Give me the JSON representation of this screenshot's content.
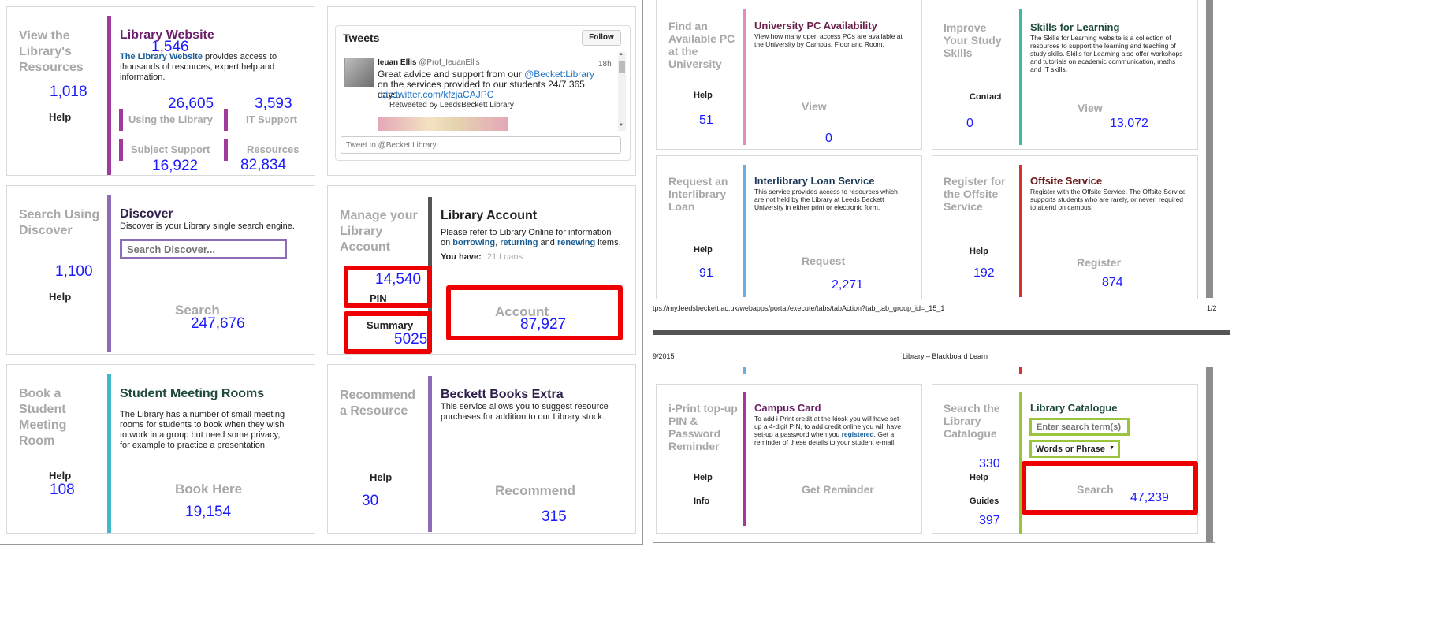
{
  "colors": {
    "purple": "#8e44ad",
    "magenta": "#a13a9b",
    "gray_bar": "#555555",
    "teal": "#3fb8b0",
    "pink": "#e07bb5",
    "blue_bar": "#6aaee0",
    "red_bar": "#d9322b",
    "green_bar": "#9ac43a",
    "red_box": "#ee0000",
    "num_blue": "#1a1aff"
  },
  "left": {
    "resources": {
      "label": "View the Library's Resources",
      "title": "Library Website",
      "title_count": "1,546",
      "desc_link": "The Library Website",
      "desc_rest": " provides access to thousands of resources, expert help and information.",
      "count": "1,018",
      "help": "Help",
      "sub": [
        {
          "label": "Using the Library",
          "count": "26,605"
        },
        {
          "label": "IT Support",
          "count": "3,593"
        },
        {
          "label": "Subject Support",
          "count": "16,922"
        },
        {
          "label": "Resources",
          "count": "82,834"
        }
      ]
    },
    "tweets": {
      "title": "Tweets",
      "follow": "Follow",
      "author": "Ieuan Ellis",
      "handle": "@Prof_IeuanEllis",
      "time": "18h",
      "text1": "Great advice and support from our ",
      "mention": "@BeckettLibrary",
      "text2": " on the services provided to our students 24/7 365 days.",
      "url": "pic.twitter.com/kfzjaCAJPC",
      "retweet": "Retweeted by LeedsBeckett Library",
      "compose_placeholder": "Tweet to @BeckettLibrary"
    },
    "discover": {
      "label": "Search Using Discover",
      "title": "Discover",
      "desc": "Discover is your Library single search engine.",
      "search_placeholder": "Search Discover...",
      "count": "1,100",
      "help": "Help",
      "search": "Search",
      "search_count": "247,676"
    },
    "account": {
      "label": "Manage your Library Account",
      "title": "Library Account",
      "desc1": "Please refer to Library Online for information on ",
      "b1": "borrowing",
      "sep1": ", ",
      "b2": "returning",
      "sep2": " and ",
      "b3": "renewing",
      "desc2": " items.",
      "you_have": "You have:",
      "loans": "21 Loans",
      "pin_count": "14,540",
      "pin": "PIN",
      "summary": "Summary",
      "summary_count": "5025",
      "account": "Account",
      "account_count": "87,927"
    },
    "rooms": {
      "label": "Book a Student Meeting Room",
      "title": "Student Meeting Rooms",
      "desc": "The Library has a number of small meeting rooms for students to book when they wish to work in a group but need some privacy, for example to practice a presentation.",
      "help": "Help",
      "help_count": "108",
      "book": "Book Here",
      "book_count": "19,154"
    },
    "recommend": {
      "label": "Recommend a Resource",
      "title": "Beckett Books Extra",
      "desc": "This service allows you to suggest resource purchases for addition to our Library stock.",
      "help": "Help",
      "help_count": "30",
      "recommend": "Recommend",
      "recommend_count": "315"
    }
  },
  "right": {
    "pc": {
      "label": "Find an Available PC at the University",
      "title": "University PC Availability",
      "desc": "View how many open access PCs are available at the University by Campus, Floor and Room.",
      "help": "Help",
      "help_count": "51",
      "view": "View",
      "view_count": "0"
    },
    "skills": {
      "label": "Improve Your Study Skills",
      "title": "Skills for Learning",
      "desc": "The Skills for Learning website is a collection of resources to support the learning and teaching of study skills. Skills for Learning also offer workshops and tutorials on academic communication, maths and IT skills.",
      "contact": "Contact",
      "contact_count": "0",
      "view": "View",
      "view_count": "13,072"
    },
    "ill": {
      "label": "Request an Interlibrary Loan",
      "title": "Interlibrary Loan Service",
      "desc": "This service provides access to resources which are not held by the Library at Leeds Beckett University in either print or electronic form.",
      "help": "Help",
      "help_count": "91",
      "request": "Request",
      "request_count": "2,271"
    },
    "offsite": {
      "label": "Register for the Offsite Service",
      "title": "Offsite Service",
      "desc": "Register with the Offsite Service. The Offsite Service supports students who are rarely, or never, required to attend on campus.",
      "help": "Help",
      "help_count": "192",
      "register": "Register",
      "register_count": "874"
    },
    "footer_url": "tps://my.leedsbeckett.ac.uk/webapps/portal/execute/tabs/tabAction?tab_tab_group_id=_15_1",
    "footer_page": "1/2",
    "header_date": "9/2015",
    "header_title": "Library – Blackboard Learn",
    "campus": {
      "label": "i-Print top-up PIN & Password Reminder",
      "title": "Campus Card",
      "desc1": "To add i-Print credit at the kiosk you will have set-up a 4-digit PIN, to add credit online you will have set-up a password when you ",
      "desc_link": "registered",
      "desc2": ". Get a reminder of these details to your student e-mail.",
      "help": "Help",
      "info": "Info",
      "reminder": "Get Reminder"
    },
    "catalogue": {
      "label": "Search the Library Catalogue",
      "title": "Library Catalogue",
      "search_placeholder": "Enter search term(s)",
      "select_value": "Words or Phrase",
      "count": "330",
      "help": "Help",
      "guides": "Guides",
      "guides_count": "397",
      "search": "Search",
      "search_count": "47,239"
    }
  }
}
